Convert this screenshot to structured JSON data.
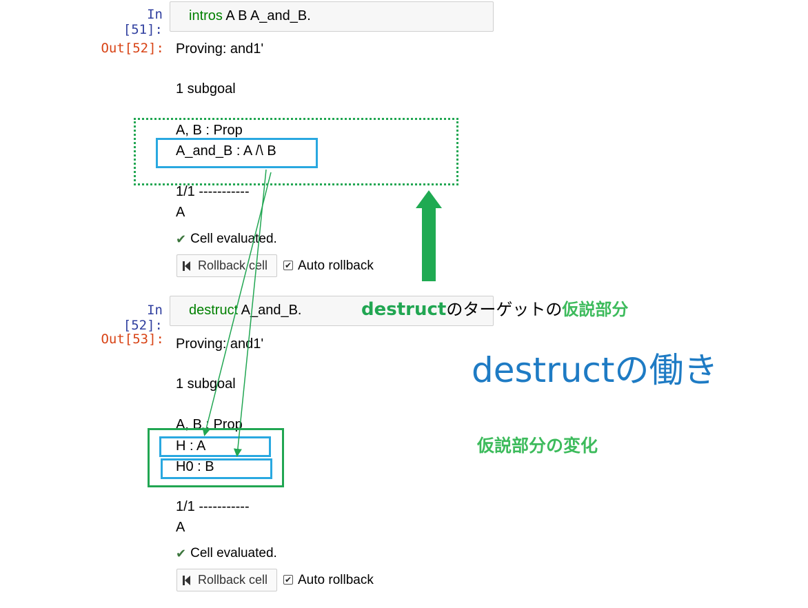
{
  "cells": [
    {
      "in_prompt": "In [51]:",
      "in_keyword": "intros",
      "in_rest": " A B A_and_B.",
      "out_prompt": "Out[52]:",
      "proving": "Proving: and1'",
      "subgoal": "1 subgoal",
      "hyp_lines": [
        "A, B : Prop",
        "A_and_B : A /\\ B"
      ],
      "separator": "1/1 -----------",
      "goal": "A",
      "status": "Cell evaluated.",
      "rollback_label": "Rollback cell",
      "auto_rollback_label": "Auto rollback",
      "auto_rollback_checked": true
    },
    {
      "in_prompt": "In [52]:",
      "in_keyword": "destruct",
      "in_rest": " A_and_B.",
      "out_prompt": "Out[53]:",
      "proving": "Proving: and1'",
      "subgoal": "1 subgoal",
      "hyp_lines": [
        "A, B : Prop",
        "H : A",
        "H0 : B"
      ],
      "separator": "1/1 -----------",
      "goal": "A",
      "status": "Cell evaluated.",
      "rollback_label": "Rollback cell",
      "auto_rollback_label": "Auto rollback",
      "auto_rollback_checked": true
    }
  ],
  "annotations": {
    "target_kw": "destruct",
    "target_mid": "のターゲットの",
    "target_end": "仮説部分",
    "title": "destructの働き",
    "change": "仮説部分の変化"
  },
  "colors": {
    "prompt_in": "#303f9f",
    "prompt_out": "#d84315",
    "keyword": "#008000",
    "annotation_green": "#21a652",
    "highlight_blue": "#29a8e0",
    "title_blue": "#1e7bc4"
  },
  "icons": [
    "check-icon",
    "rollback-icon",
    "checkbox-icon",
    "up-arrow"
  ]
}
